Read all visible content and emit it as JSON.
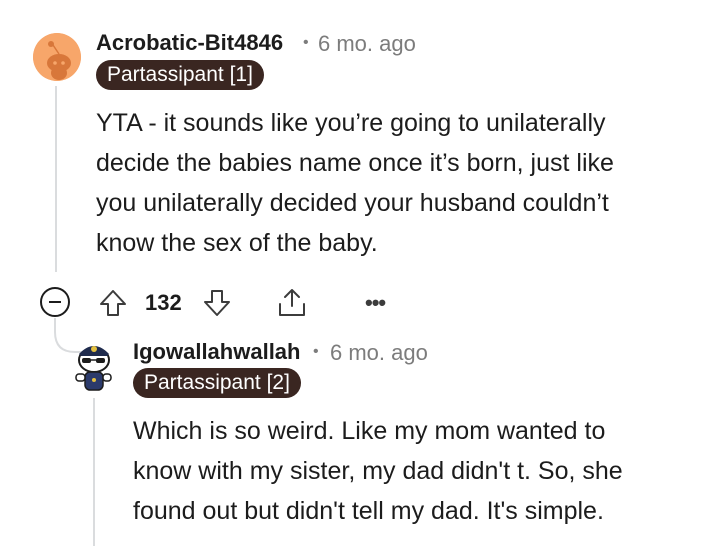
{
  "comments": [
    {
      "username": "Acrobatic-Bit4846",
      "separator": "•",
      "time": "6 mo. ago",
      "flair": "Partassipant [1]",
      "avatar_icon": "reddit-snoo-avatar-orange",
      "body_lines": [
        "YTA - it sounds like you’re going to unilaterally",
        "decide the babies name once it’s born, just like",
        "you unilaterally decided your husband couldn’t",
        "know the sex of the baby."
      ],
      "actions": {
        "collapse_icon": "minus-circle-icon",
        "upvote_icon": "upvote-arrow-icon",
        "score": "132",
        "downvote_icon": "downvote-arrow-icon",
        "share_icon": "share-icon",
        "more_label": "•••"
      }
    },
    {
      "username": "Igowallahwallah",
      "separator": "•",
      "time": "6 mo. ago",
      "flair": "Partassipant [2]",
      "avatar_icon": "reddit-snoo-avatar-police",
      "body_lines": [
        "Which is so weird. Like my mom wanted to",
        "know with my sister, my dad didn't t. So, she",
        "found out but didn't tell my dad. It's simple."
      ]
    }
  ],
  "colors": {
    "flair_bg": "#3a2621",
    "avatar_orange": "#f7a66a",
    "thread_line": "#dadcde",
    "meta_gray": "#7c7c7c"
  }
}
